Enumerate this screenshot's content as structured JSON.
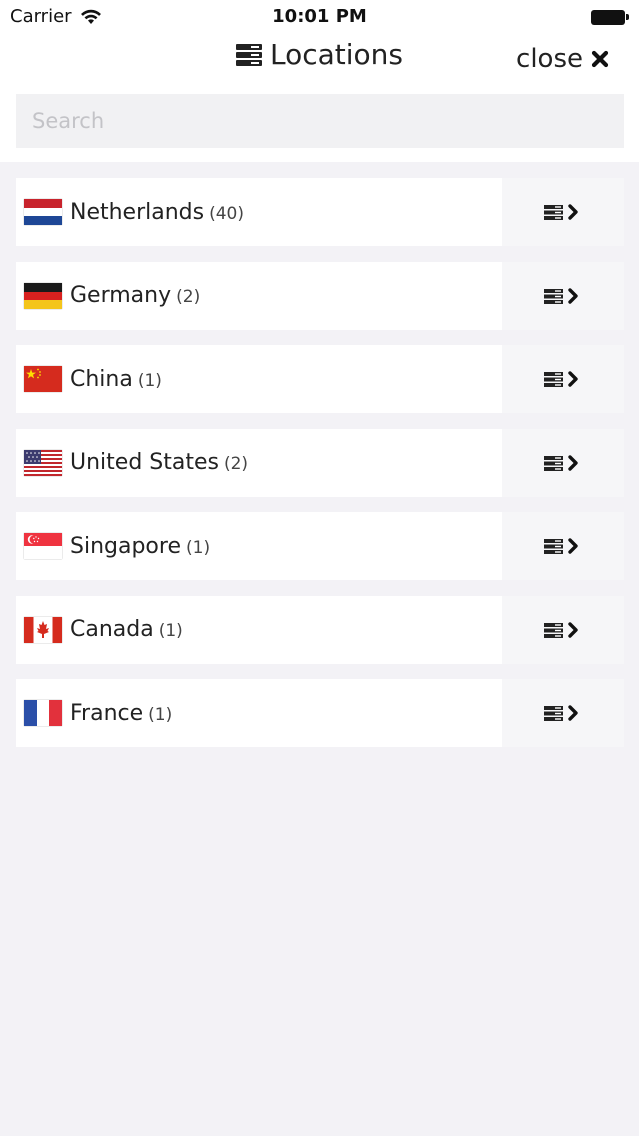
{
  "status_bar": {
    "carrier": "Carrier",
    "time": "10:01 PM"
  },
  "header": {
    "title": "Locations",
    "title_icon": "server-stack-icon",
    "close_label": "close",
    "close_icon": "close-x-icon"
  },
  "search": {
    "placeholder": "Search",
    "value": ""
  },
  "locations": [
    {
      "name": "Netherlands",
      "count": "(40)",
      "flag": "netherlands-flag-icon"
    },
    {
      "name": "Germany",
      "count": "(2)",
      "flag": "germany-flag-icon"
    },
    {
      "name": "China",
      "count": "(1)",
      "flag": "china-flag-icon"
    },
    {
      "name": "United States",
      "count": "(2)",
      "flag": "usa-flag-icon"
    },
    {
      "name": "Singapore",
      "count": "(1)",
      "flag": "singapore-flag-icon"
    },
    {
      "name": "Canada",
      "count": "(1)",
      "flag": "canada-flag-icon"
    },
    {
      "name": "France",
      "count": "(1)",
      "flag": "france-flag-icon"
    }
  ],
  "row_action_icon": "server-chevron-right-icon",
  "colors": {
    "background": "#f3f2f6",
    "row_background": "#ffffff",
    "action_background": "#f6f6f8",
    "search_background": "#f1f1f3"
  }
}
